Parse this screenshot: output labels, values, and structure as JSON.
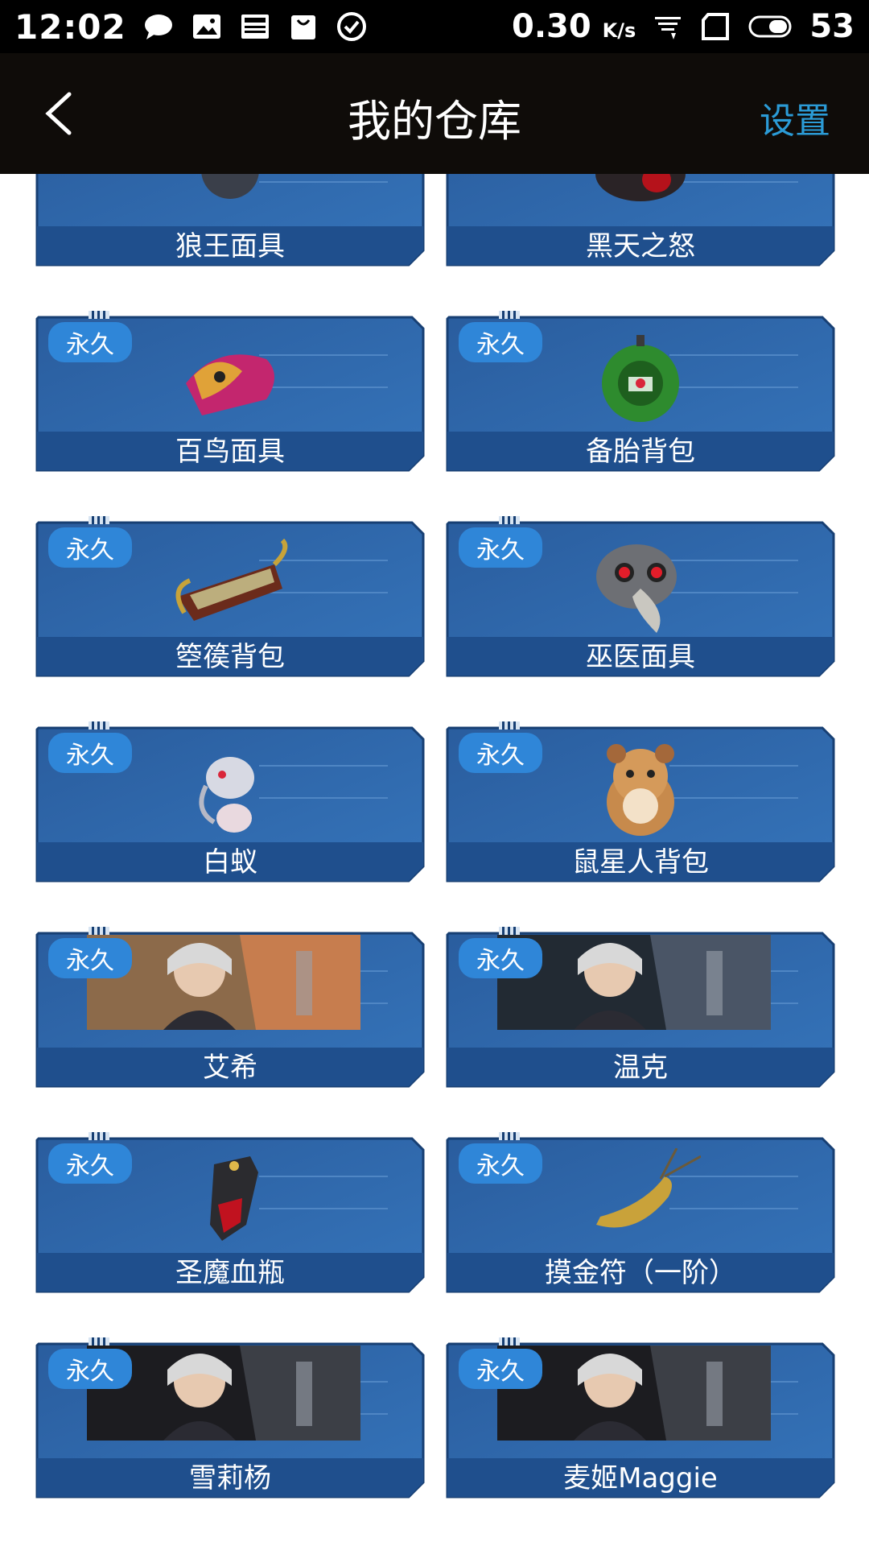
{
  "status_bar": {
    "time": "12:02",
    "net_speed": "0.30",
    "net_unit": "K/s",
    "battery": "53",
    "icons": [
      "chat-bubble-icon",
      "gallery-icon",
      "news-icon",
      "bag-icon",
      "check-circle-icon",
      "wifi-icon",
      "no-sim-icon",
      "battery-icon"
    ]
  },
  "nav": {
    "title": "我的仓库",
    "settings_label": "设置",
    "back_icon": "back-arrow-icon"
  },
  "badge_label": "永久",
  "colors": {
    "accent": "#2b9bd6",
    "card_bg": "#2f66a8",
    "card_bar": "#1f4f8d",
    "badge": "#2f86d8"
  },
  "items": [
    {
      "name": "狼王面具",
      "badge": false,
      "icon": "wolf-mask-icon"
    },
    {
      "name": "黑天之怒",
      "badge": false,
      "icon": "dark-ring-icon"
    },
    {
      "name": "百鸟面具",
      "badge": true,
      "icon": "feather-mask-icon"
    },
    {
      "name": "备胎背包",
      "badge": true,
      "icon": "tire-backpack-icon"
    },
    {
      "name": "箜篌背包",
      "badge": true,
      "icon": "harp-backpack-icon"
    },
    {
      "name": "巫医面具",
      "badge": true,
      "icon": "plague-mask-icon"
    },
    {
      "name": "白蚁",
      "badge": true,
      "icon": "white-ant-icon"
    },
    {
      "name": "鼠星人背包",
      "badge": true,
      "icon": "hamster-backpack-icon"
    },
    {
      "name": "艾希",
      "badge": true,
      "icon": "character-portrait-icon"
    },
    {
      "name": "温克",
      "badge": true,
      "icon": "character-portrait-icon"
    },
    {
      "name": "圣魔血瓶",
      "badge": true,
      "icon": "blood-vial-icon"
    },
    {
      "name": "摸金符（一阶）",
      "badge": true,
      "icon": "golden-talisman-icon"
    },
    {
      "name": "雪莉杨",
      "badge": true,
      "icon": "character-portrait-icon"
    },
    {
      "name": "麦姬Maggie",
      "badge": true,
      "icon": "character-portrait-icon"
    }
  ]
}
